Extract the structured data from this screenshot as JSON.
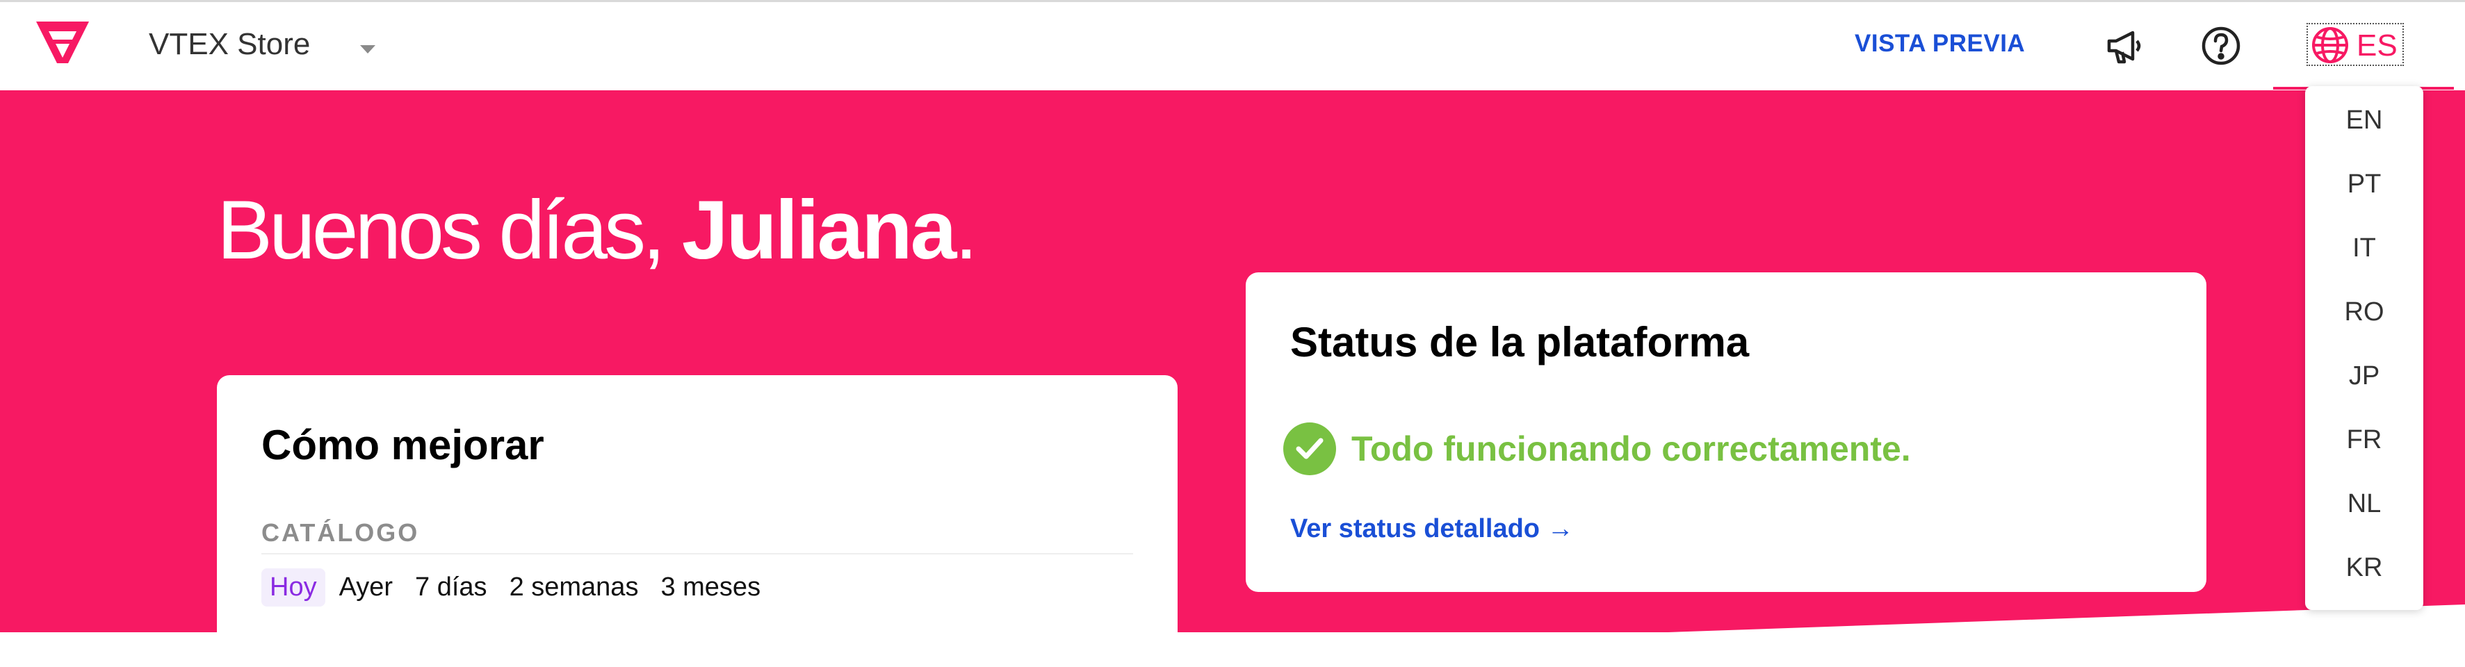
{
  "topbar": {
    "store_name": "VTEX Store",
    "preview_label": "VISTA PREVIA",
    "current_language": "ES",
    "icons": [
      "vtex-logo-icon",
      "chevron-down-icon",
      "megaphone-icon",
      "help-icon",
      "globe-icon"
    ]
  },
  "hero": {
    "greeting": "Buenos días,",
    "user_name": "Juliana",
    "punctuation": "."
  },
  "improve_card": {
    "title": "Cómo mejorar",
    "section_label": "CATÁLOGO",
    "periods": [
      "Hoy",
      "Ayer",
      "7 días",
      "2 semanas",
      "3 meses"
    ],
    "selected_period": "Hoy"
  },
  "status_card": {
    "title": "Status de la plataforma",
    "status_text": "Todo funcionando correctamente.",
    "link_text": "Ver status detallado →"
  },
  "language_menu": {
    "options": [
      "EN",
      "PT",
      "IT",
      "RO",
      "JP",
      "FR",
      "NL",
      "KR"
    ]
  },
  "colors": {
    "brand_pink": "#f71963",
    "link_blue": "#1a4fd6",
    "success_green": "#79c142"
  }
}
